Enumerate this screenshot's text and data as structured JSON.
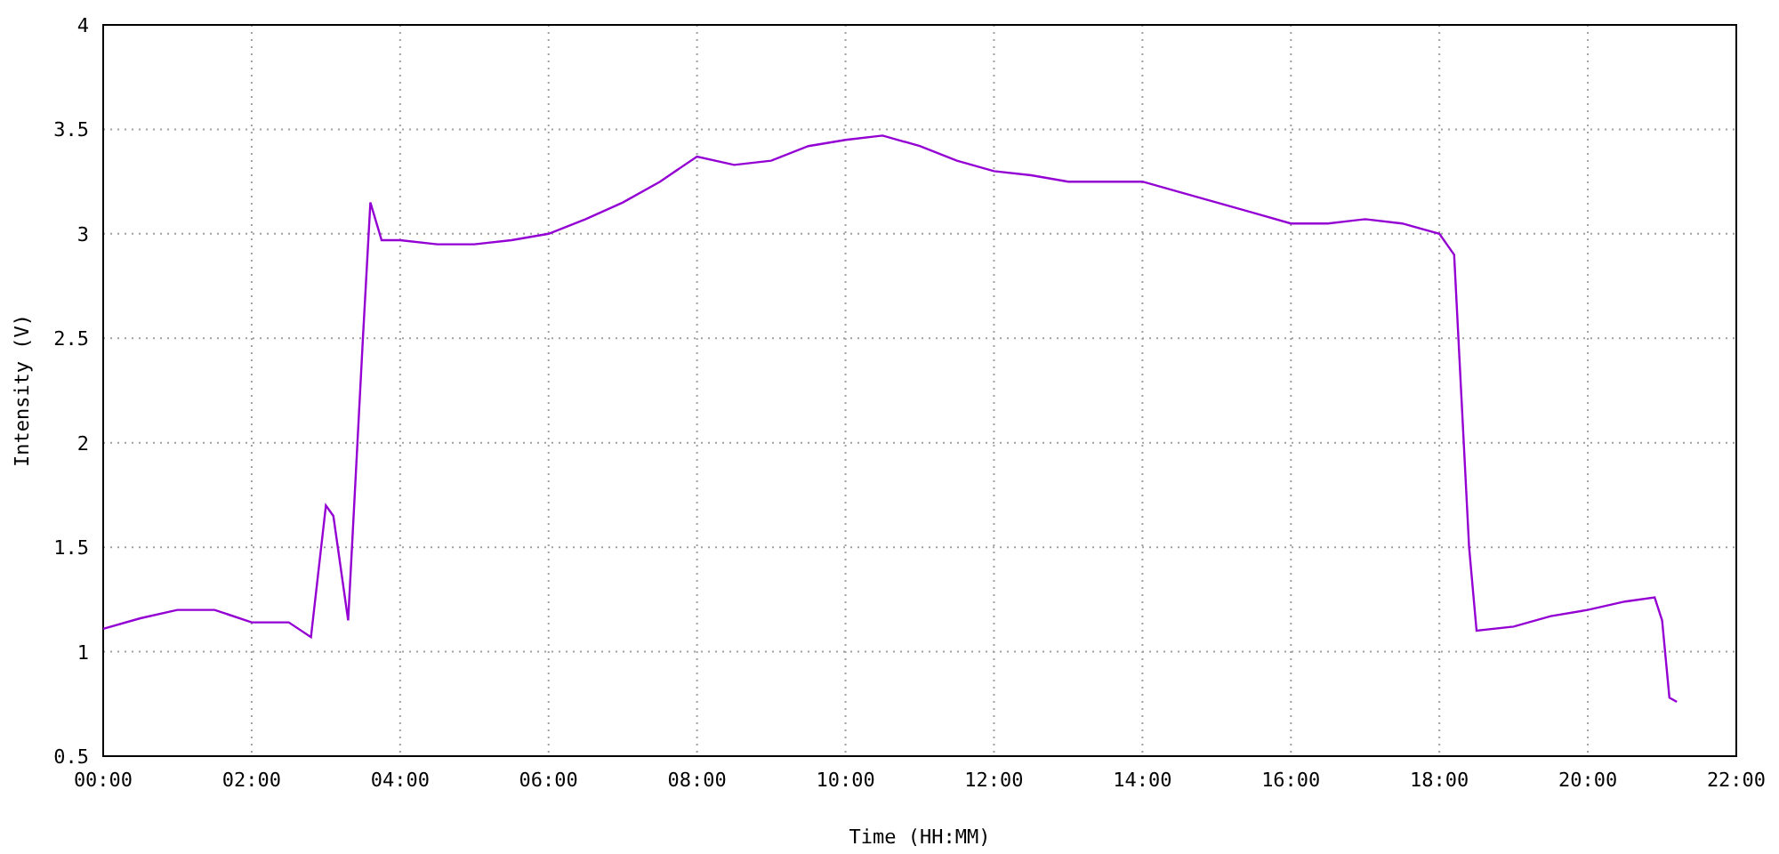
{
  "chart_data": {
    "type": "line",
    "xlabel": "Time (HH:MM)",
    "ylabel": "Intensity (V)",
    "x": [
      0,
      0.5,
      1,
      1.5,
      2,
      2.5,
      2.8,
      3,
      3.1,
      3.3,
      3.5,
      3.6,
      3.75,
      4,
      4.5,
      5,
      5.5,
      6,
      6.5,
      7,
      7.5,
      8,
      8.5,
      9,
      9.5,
      10,
      10.5,
      11,
      11.5,
      12,
      12.5,
      13,
      13.5,
      14,
      14.5,
      15,
      15.5,
      16,
      16.5,
      17,
      17.5,
      18,
      18.2,
      18.3,
      18.4,
      18.5,
      19,
      19.5,
      20,
      20.5,
      20.9,
      21,
      21.1,
      21.2
    ],
    "grid": true,
    "series": [
      {
        "color": "#9400d3",
        "values": [
          1.11,
          1.16,
          1.2,
          1.2,
          1.14,
          1.14,
          1.07,
          1.7,
          1.65,
          1.15,
          2.5,
          3.15,
          2.97,
          2.97,
          2.95,
          2.95,
          2.97,
          3.0,
          3.07,
          3.15,
          3.25,
          3.37,
          3.33,
          3.35,
          3.42,
          3.45,
          3.47,
          3.42,
          3.35,
          3.3,
          3.28,
          3.25,
          3.25,
          3.25,
          3.2,
          3.15,
          3.1,
          3.05,
          3.05,
          3.07,
          3.05,
          3.0,
          2.9,
          2.2,
          1.5,
          1.1,
          1.12,
          1.17,
          1.2,
          1.24,
          1.26,
          1.15,
          0.78,
          0.76
        ]
      }
    ],
    "xlim": [
      0,
      22
    ],
    "ylim": [
      0.5,
      4
    ],
    "xticks": [
      {
        "value": 0,
        "label": "00:00"
      },
      {
        "value": 2,
        "label": "02:00"
      },
      {
        "value": 4,
        "label": "04:00"
      },
      {
        "value": 6,
        "label": "06:00"
      },
      {
        "value": 8,
        "label": "08:00"
      },
      {
        "value": 10,
        "label": "10:00"
      },
      {
        "value": 12,
        "label": "12:00"
      },
      {
        "value": 14,
        "label": "14:00"
      },
      {
        "value": 16,
        "label": "16:00"
      },
      {
        "value": 18,
        "label": "18:00"
      },
      {
        "value": 20,
        "label": "20:00"
      },
      {
        "value": 22,
        "label": "22:00"
      }
    ],
    "yticks": [
      {
        "value": 0.5,
        "label": "0.5"
      },
      {
        "value": 1,
        "label": "1"
      },
      {
        "value": 1.5,
        "label": "1.5"
      },
      {
        "value": 2,
        "label": "2"
      },
      {
        "value": 2.5,
        "label": "2.5"
      },
      {
        "value": 3,
        "label": "3"
      },
      {
        "value": 3.5,
        "label": "3.5"
      },
      {
        "value": 4,
        "label": "4"
      }
    ]
  }
}
